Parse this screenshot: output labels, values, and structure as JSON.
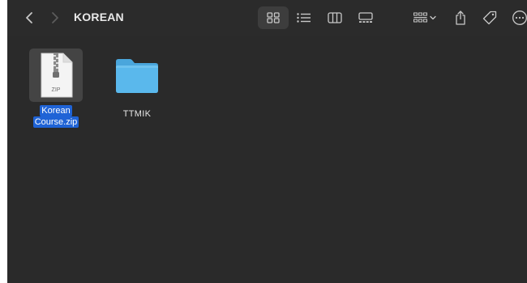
{
  "window": {
    "title": "KOREAN",
    "colors": {
      "background": "#2a2a2a",
      "selection": "#1f63d6",
      "folder": "#5ab8ec"
    }
  },
  "toolbar": {
    "back_icon": "chevron-left-icon",
    "forward_icon": "chevron-right-icon",
    "view_modes": [
      "icon-view-icon",
      "list-view-icon",
      "column-view-icon",
      "gallery-view-icon"
    ],
    "active_view": "icon-view-icon",
    "group_icon": "group-grid-icon",
    "share_icon": "share-icon",
    "tag_icon": "tag-icon",
    "more_icon": "ellipsis-circle-icon"
  },
  "files": [
    {
      "name_line1": "Korean",
      "name_line2": "Course.zip",
      "type": "zip",
      "badge": "ZIP",
      "selected": true
    },
    {
      "name": "TTMIK",
      "type": "folder",
      "selected": false
    }
  ]
}
